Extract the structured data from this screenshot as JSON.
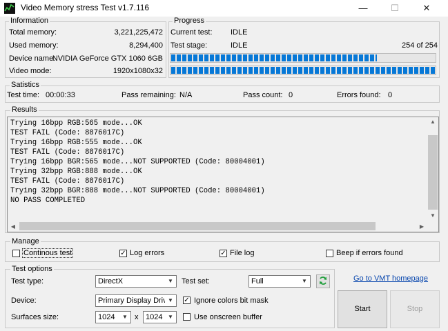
{
  "window": {
    "title": "Video Memory stress Test v1.7.116",
    "minimize": "—",
    "maximize": "☐",
    "close": "✕"
  },
  "information": {
    "legend": "Information",
    "total_memory_label": "Total memory:",
    "total_memory": "3,221,225,472",
    "used_memory_label": "Used memory:",
    "used_memory": "8,294,400",
    "device_name_label": "Device name:",
    "device_name": "NVIDIA GeForce GTX 1060 6GB",
    "video_mode_label": "Video mode:",
    "video_mode": "1920x1080x32"
  },
  "progress": {
    "legend": "Progress",
    "current_test_label": "Current test:",
    "current_test": "IDLE",
    "test_stage_label": "Test stage:",
    "test_stage": "IDLE",
    "stage_count": "254 of 254",
    "bar1_fraction": 0.78,
    "bar2_fraction": 1.0
  },
  "statistics": {
    "legend": "Satistics",
    "test_time_label": "Test time:",
    "test_time": "00:00:33",
    "pass_remaining_label": "Pass remaining:",
    "pass_remaining": "N/A",
    "pass_count_label": "Pass count:",
    "pass_count": "0",
    "errors_found_label": "Errors found:",
    "errors_found": "0"
  },
  "results": {
    "legend": "Results",
    "lines": [
      "Trying 16bpp RGB:565 mode...OK",
      "TEST FAIL (Code: 8876017C)",
      "Trying 16bpp RGB:555 mode...OK",
      "TEST FAIL (Code: 8876017C)",
      "Trying 16bpp BGR:565 mode...NOT SUPPORTED (Code: 80004001)",
      "Trying 32bpp RGB:888 mode...OK",
      "TEST FAIL (Code: 8876017C)",
      "Trying 32bpp BGR:888 mode...NOT SUPPORTED (Code: 80004001)",
      "NO PASS COMPLETED"
    ]
  },
  "manage": {
    "legend": "Manage",
    "continous_test": "Continous test",
    "continous_checked": false,
    "log_errors": "Log errors",
    "log_errors_checked": true,
    "file_log": "File log",
    "file_log_checked": true,
    "beep": "Beep if errors found",
    "beep_checked": false
  },
  "test_options": {
    "legend": "Test options",
    "test_type_label": "Test type:",
    "test_type": "DirectX",
    "test_set_label": "Test set:",
    "test_set": "Full",
    "device_label": "Device:",
    "device": "Primary Display Drive",
    "ignore_colors": "Ignore colors bit mask",
    "ignore_colors_checked": true,
    "surfaces_label": "Surfaces size:",
    "surface_w": "1024",
    "x_sep": "x",
    "surface_h": "1024",
    "onscreen": "Use onscreen buffer",
    "onscreen_checked": false
  },
  "vmt_link": "Go to VMT homepage",
  "start_button": "Start",
  "stop_button": "Stop",
  "colors": {
    "progress_blue": "#0678d7",
    "link": "#0645ad",
    "refresh_green": "#1e9e3a"
  }
}
